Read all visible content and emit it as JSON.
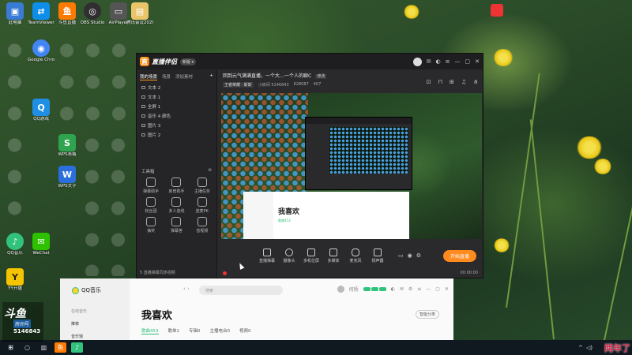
{
  "desktop": {
    "icons": [
      {
        "label": "此电脑",
        "icon": "computer-icon",
        "color": "#3a7bd5"
      },
      {
        "label": "TeamViewer",
        "icon": "teamviewer-icon",
        "color": "#0e8ee9"
      },
      {
        "label": "斗鱼直播",
        "icon": "douyu-icon",
        "color": "#ff7a00"
      },
      {
        "label": "OBS Studio",
        "icon": "obs-icon",
        "color": "#302e31"
      },
      {
        "label": "AirPlayer",
        "icon": "airplayer-icon",
        "color": "#555555"
      },
      {
        "label": "腾讯会议2020...",
        "icon": "folder-icon",
        "color": "#e9c46a"
      },
      {
        "label": "Google Chrome",
        "icon": "chrome-icon",
        "color": "#4285f4"
      },
      {
        "label": "QQ游戏",
        "icon": "qqgame-icon",
        "color": "#1f8fe5"
      },
      {
        "label": "WPS表格",
        "icon": "wps-icon",
        "color": "#2ea44f"
      },
      {
        "label": "WPS文字",
        "icon": "wps-icon",
        "color": "#2a6fdb"
      },
      {
        "label": "QQ音乐",
        "icon": "qqmusic-icon",
        "color": "#31c27c"
      },
      {
        "label": "WeChat",
        "icon": "wechat-icon",
        "color": "#2dc100"
      },
      {
        "label": "YY开播",
        "icon": "yy-icon",
        "color": "#f5c400"
      }
    ]
  },
  "stream_app": {
    "name": "直播伴侣",
    "version_tag": "新版 ▾",
    "left_tabs": [
      "我的场景",
      "场景",
      "添加素材"
    ],
    "scenes": [
      "文本 2",
      "文本 1",
      "全屏 1",
      "音乐 4 颜色",
      "图片 3",
      "图片 2"
    ],
    "toolbox_title": "工具箱",
    "tools": [
      "弹幕助手",
      "房管助手",
      "主播任务",
      "粉丝团",
      "多人连线",
      "连麦PK",
      "抽奖",
      "弹幕答",
      "音视频"
    ],
    "footer_note": "5 直播弹幕同步视频",
    "room_title": "回到元气满满直播，一个大…一个人的聊C",
    "room_edit": "修改",
    "category": "王者荣耀 · 斯斯",
    "room_id_label": "小房间 5146843",
    "stat_views": "628087",
    "stat_count": "407",
    "controls": [
      "直播弹幕",
      "摄像头",
      "多机位屏",
      "多媒体",
      "麦克风",
      "扬声器"
    ],
    "start_button": "开始直播",
    "timer": "00:00:00"
  },
  "mini_preview": {
    "qq_title": "我喜欢"
  },
  "qq_music": {
    "app_name": "QQ音乐",
    "nav_section": "在线音乐",
    "nav_items": [
      "推荐",
      "音乐馆"
    ],
    "search_placeholder": "搜索",
    "heading": "我喜欢",
    "tabs": [
      "歌曲453",
      "歌单1",
      "专辑0",
      "主播电台0",
      "视频0"
    ],
    "smart_sort": "智能分类",
    "user": "何杨"
  },
  "overlay": {
    "room_label": "房间号",
    "room_number": "5146843",
    "watermark": "两年了"
  },
  "colors": {
    "accent_orange": "#ff8a1e",
    "qq_green": "#31c27c",
    "watermark_red": "#d72a4a"
  }
}
